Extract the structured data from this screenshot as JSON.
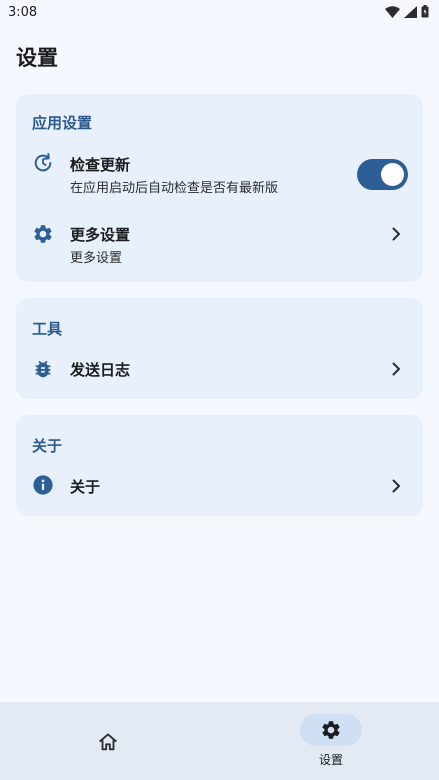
{
  "status_bar": {
    "time": "3:08",
    "icons": [
      "wifi-icon",
      "signal-icon",
      "battery-icon"
    ]
  },
  "page": {
    "title": "设置"
  },
  "sections": {
    "app_settings": {
      "title": "应用设置",
      "check_update": {
        "icon": "refresh-clock-icon",
        "title": "检查更新",
        "subtitle": "在应用启动后自动检查是否有最新版",
        "toggle_on": true
      },
      "more_settings": {
        "icon": "gear-icon",
        "title": "更多设置",
        "subtitle": "更多设置"
      }
    },
    "tools": {
      "title": "工具",
      "send_log": {
        "icon": "bug-icon",
        "title": "发送日志"
      }
    },
    "about": {
      "title": "关于",
      "about_item": {
        "icon": "info-icon",
        "title": "关于"
      }
    }
  },
  "bottom_nav": {
    "home_icon": "home-icon",
    "settings_icon": "gear-icon",
    "settings_label": "设置",
    "selected": "settings"
  },
  "colors": {
    "background": "#f5f9ff",
    "card": "#e8f0fb",
    "accent": "#2d5f97",
    "section_title": "#2d5a8c",
    "nav_background": "#e3eaf4",
    "nav_pill": "#cfe0f5"
  }
}
